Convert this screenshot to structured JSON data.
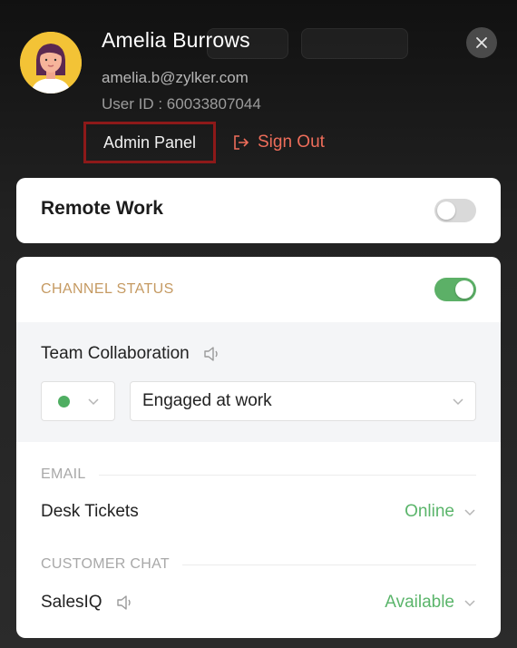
{
  "user": {
    "name": "Amelia Burrows",
    "email": "amelia.b@zylker.com",
    "user_id": "User ID : 60033807044"
  },
  "actions": {
    "admin_panel": "Admin Panel",
    "sign_out": "Sign Out"
  },
  "remote_work": {
    "label": "Remote Work",
    "enabled": false
  },
  "channel_status": {
    "heading": "CHANNEL STATUS",
    "enabled": true,
    "team": {
      "title": "Team Collaboration",
      "status_color": "#4fae62",
      "status_text": "Engaged at work"
    },
    "categories": [
      {
        "label": "EMAIL",
        "items": [
          {
            "label": "Desk Tickets",
            "status": "Online",
            "sound_icon": false
          }
        ]
      },
      {
        "label": "CUSTOMER CHAT",
        "items": [
          {
            "label": "SalesIQ",
            "status": "Available",
            "sound_icon": true
          }
        ]
      }
    ]
  },
  "colors": {
    "accent_green": "#5cb067",
    "sign_out_red": "#ee6d5a",
    "highlight_border": "#8d1919",
    "section_heading": "#c59a62"
  },
  "icons": [
    "user-avatar",
    "sign-out-icon",
    "close-icon",
    "speaker-icon",
    "chevron-down-icon"
  ]
}
